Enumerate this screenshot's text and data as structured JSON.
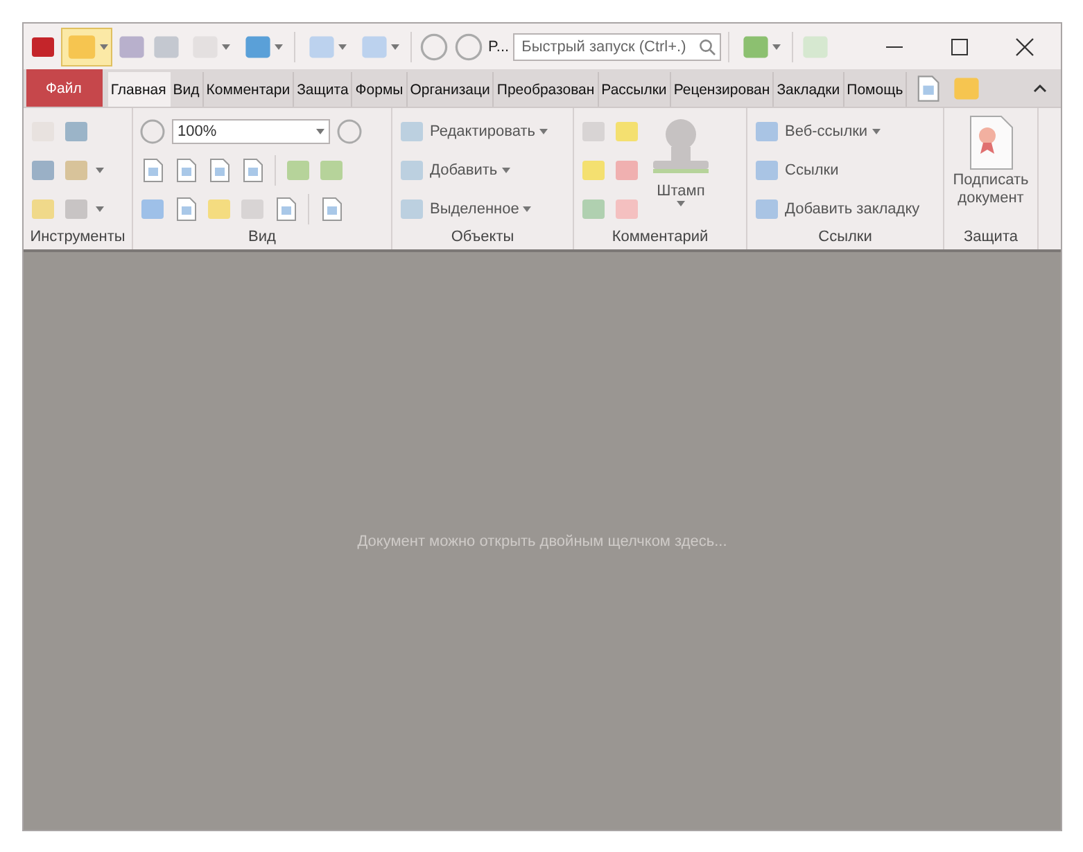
{
  "toolbar": {
    "overflow_label": "P...",
    "search": {
      "placeholder": "Быстрый запуск (Ctrl+.)"
    }
  },
  "tabs": [
    {
      "label": "Файл",
      "kind": "file"
    },
    {
      "label": "Главная",
      "kind": "tab",
      "selected": true
    },
    {
      "label": "Вид",
      "kind": "tab",
      "selected": false
    },
    {
      "label": "Комментари",
      "kind": "tab",
      "selected": false
    },
    {
      "label": "Защита",
      "kind": "tab",
      "selected": false
    },
    {
      "label": "Формы",
      "kind": "tab",
      "selected": false
    },
    {
      "label": "Организаци",
      "kind": "tab",
      "selected": false
    },
    {
      "label": "Преобразован",
      "kind": "tab",
      "selected": false
    },
    {
      "label": "Рассылки",
      "kind": "tab",
      "selected": false
    },
    {
      "label": "Рецензирован",
      "kind": "tab",
      "selected": false
    },
    {
      "label": "Закладки",
      "kind": "tab",
      "selected": false
    },
    {
      "label": "Помощь",
      "kind": "tab",
      "selected": false
    }
  ],
  "ribbon": [
    {
      "kind": "tools",
      "label": "Инструменты"
    },
    {
      "kind": "view",
      "label": "Вид",
      "zoom_value": "100%"
    },
    {
      "kind": "objects",
      "label": "Объекты",
      "items": [
        "Редактировать",
        "Добавить",
        "Выделенное"
      ]
    },
    {
      "kind": "comments",
      "label": "Комментарий",
      "items": [
        "Штамп"
      ]
    },
    {
      "kind": "links",
      "label": "Ссылки",
      "items": [
        "Веб-ссылки",
        "Ссылки",
        "Добавить закладку"
      ]
    },
    {
      "kind": "protect",
      "label": "Защита",
      "items": [
        "Подписать документ"
      ]
    }
  ],
  "document": {
    "hint": "Документ можно открыть двойным щелчком здесь..."
  }
}
